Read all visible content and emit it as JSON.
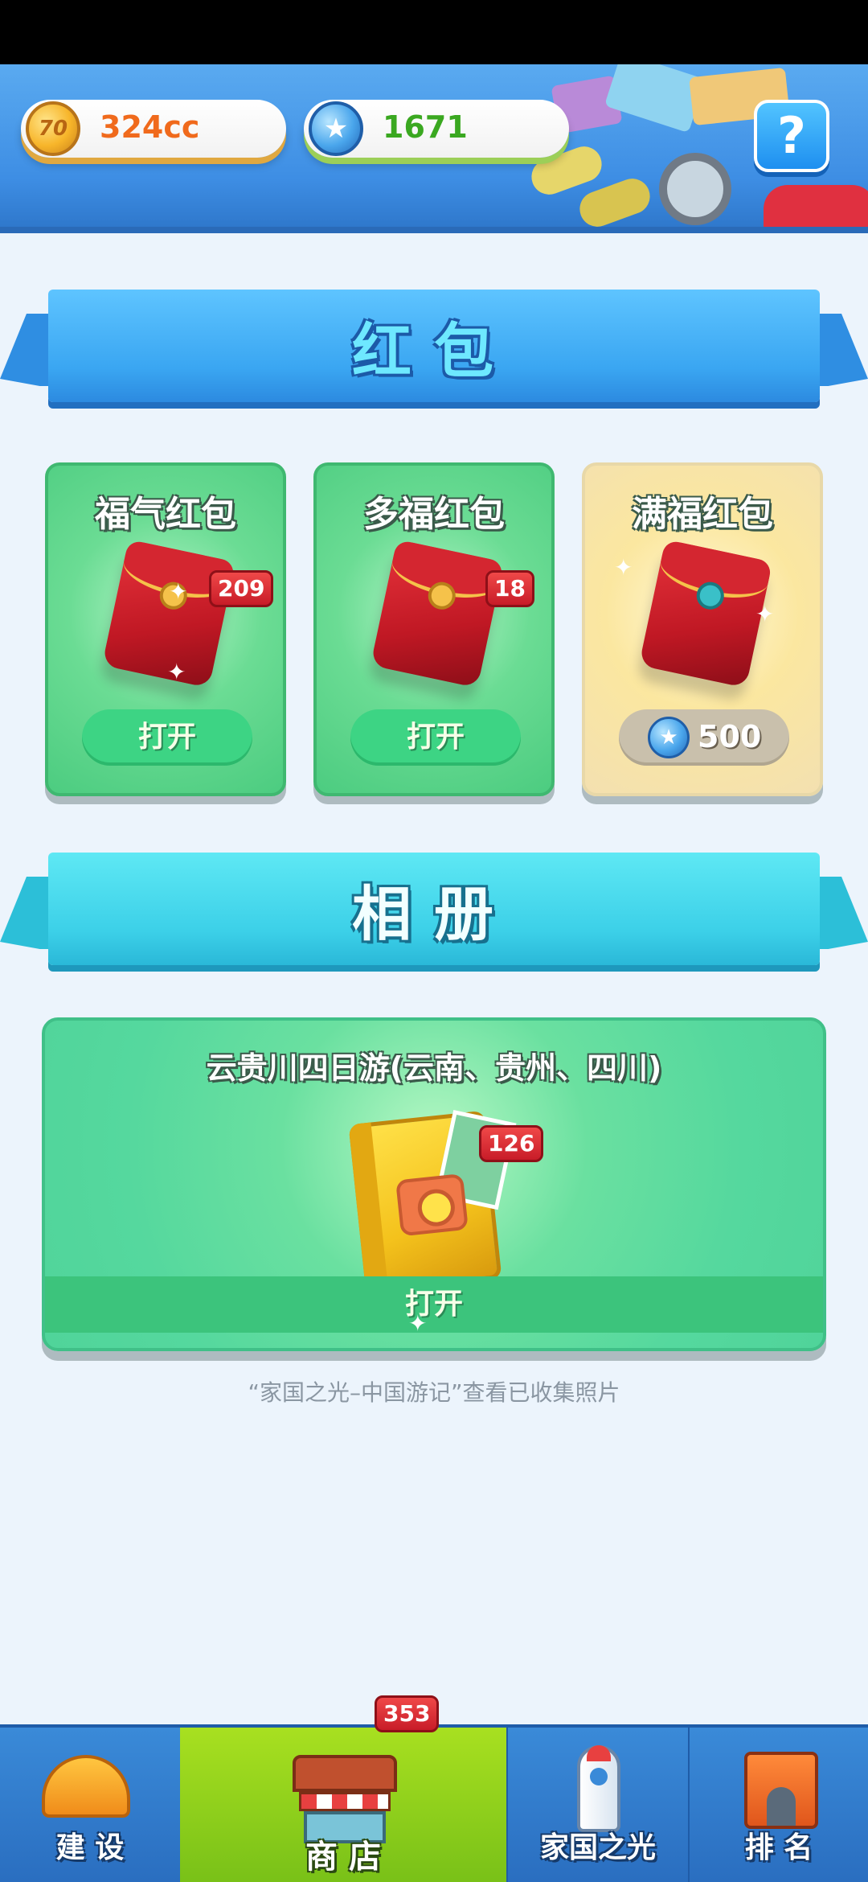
{
  "header": {
    "coins": "324cc",
    "coin_icon_text": "70",
    "gems": "1671",
    "help_label": "?"
  },
  "red_packets": {
    "section_title": "红包",
    "items": [
      {
        "title": "福气红包",
        "count": "209",
        "action": "打开"
      },
      {
        "title": "多福红包",
        "count": "18",
        "action": "打开"
      },
      {
        "title": "满福红包",
        "price": "500"
      }
    ]
  },
  "album": {
    "section_title": "相册",
    "card_title": "云贵川四日游(云南、贵州、四川)",
    "count": "126",
    "action": "打开",
    "hint": "“家国之光–中国游记”查看已收集照片"
  },
  "bottom_nav": {
    "items": [
      {
        "label": "建 设",
        "icon": "helmet-icon"
      },
      {
        "label": "商 店",
        "icon": "shop-icon",
        "badge": "353",
        "active": true
      },
      {
        "label": "家国之光",
        "icon": "rocket-icon"
      },
      {
        "label": "排 名",
        "icon": "gate-icon"
      }
    ]
  },
  "colors": {
    "header_blue": "#3e8ee4",
    "card_green": "#4ccc80",
    "card_gold": "#fbe7a0",
    "badge_red": "#c81c28",
    "shop_active_green": "#8fd01c"
  }
}
